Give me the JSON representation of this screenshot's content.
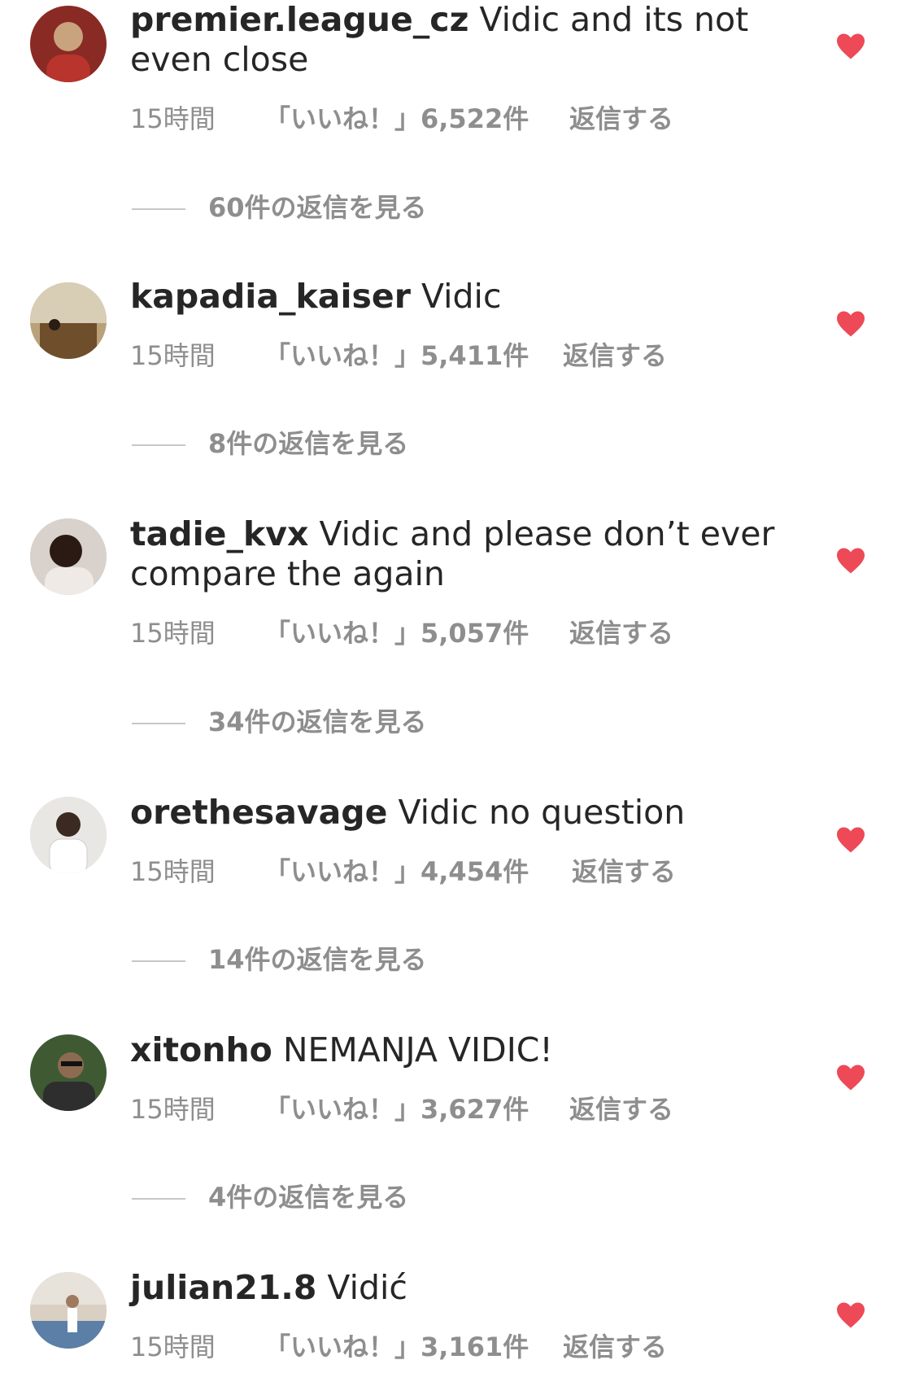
{
  "comments": [
    {
      "user": "premier.league_cz",
      "text": "Vidic and its not even close",
      "time": "15時間",
      "likes": "「いいね！」6,522件",
      "reply": "返信する",
      "view_replies": "60件の返信を見る",
      "avatar_colors": [
        "#8a2a24",
        "#c9a27e"
      ]
    },
    {
      "user": "kapadia_kaiser",
      "text": "Vidic",
      "time": "15時間",
      "likes": "「いいね！」5,411件",
      "reply": "返信する",
      "view_replies": "8件の返信を見る",
      "avatar_colors": [
        "#6f4e2c",
        "#b9a27a"
      ]
    },
    {
      "user": "tadie_kvx",
      "text": "Vidic and please don’t ever compare the again",
      "time": "15時間",
      "likes": "「いいね！」5,057件",
      "reply": "返信する",
      "view_replies": "34件の返信を見る",
      "avatar_colors": [
        "#2b1a14",
        "#d9d2cc"
      ]
    },
    {
      "user": "orethesavage",
      "text": "Vidic no question",
      "time": "15時間",
      "likes": "「いいね！」4,454件",
      "reply": "返信する",
      "view_replies": "14件の返信を見る",
      "avatar_colors": [
        "#e9e7e4",
        "#3a2a22"
      ]
    },
    {
      "user": "xitonho",
      "text": "NEMANJA VIDIC!",
      "time": "15時間",
      "likes": "「いいね！」3,627件",
      "reply": "返信する",
      "view_replies": "4件の返信を見る",
      "avatar_colors": [
        "#3f5a33",
        "#8c6b52"
      ]
    },
    {
      "user": "julian21.8",
      "text": "Vidić",
      "time": "15時間",
      "likes": "「いいね！」3,161件",
      "reply": "返信する",
      "avatar_colors": [
        "#5b7fa6",
        "#d9cfc2"
      ]
    }
  ],
  "colors": {
    "heart": "#ed4956",
    "meta": "#8e8e8e",
    "text": "#262626"
  },
  "icons": {
    "like": "heart-icon"
  }
}
